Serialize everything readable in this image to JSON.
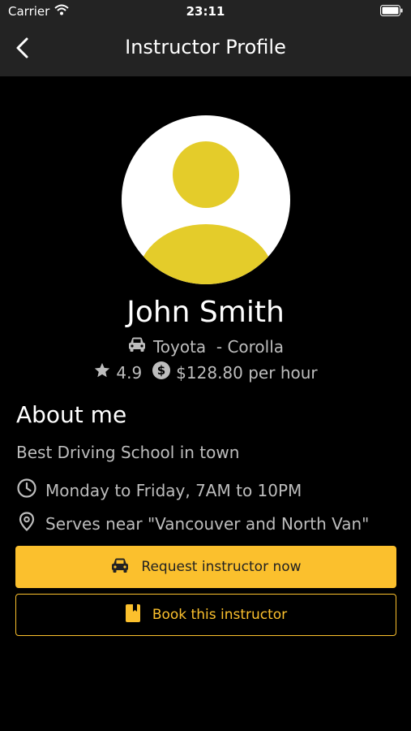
{
  "status_bar": {
    "carrier": "Carrier",
    "time": "23:11"
  },
  "nav": {
    "title": "Instructor Profile"
  },
  "profile": {
    "name": "John Smith",
    "car": "Toyota  - Corolla",
    "rating": "4.9",
    "rate": "$128.80 per hour"
  },
  "about": {
    "heading": "About me",
    "description": "Best Driving School in town",
    "hours": "Monday to Friday, 7AM to 10PM",
    "area": "Serves near \"Vancouver and North Van\""
  },
  "actions": {
    "request_label": "Request instructor now",
    "book_label": "Book this instructor"
  },
  "icons": {
    "back": "chevron-left-icon",
    "car": "car-icon",
    "star": "star-icon",
    "money": "dollar-circle-icon",
    "clock": "clock-icon",
    "location": "location-pin-icon",
    "book": "bookmark-icon",
    "wifi": "wifi-icon",
    "battery": "battery-icon"
  },
  "colors": {
    "accent": "#fbc02d",
    "avatar_figure": "#e4cc2a",
    "bar_background": "#232323",
    "background": "#000000",
    "muted_text": "#bdbdbd"
  }
}
